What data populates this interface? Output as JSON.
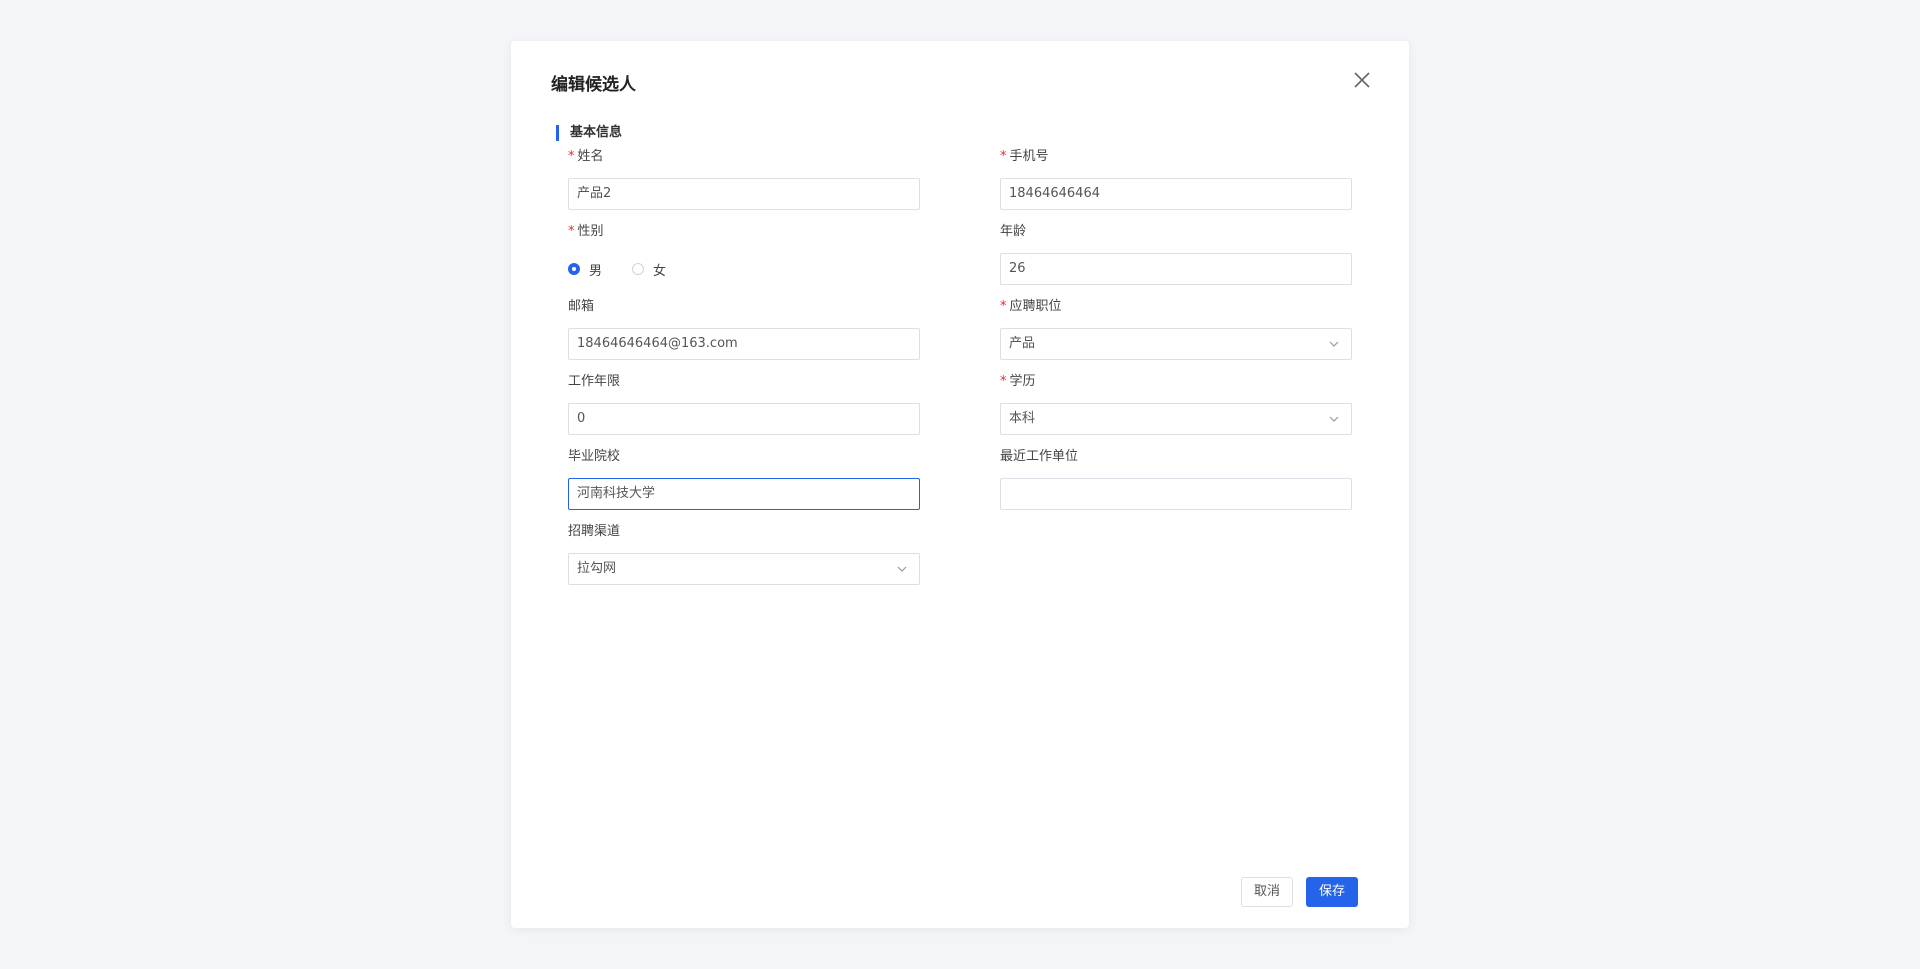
{
  "dialog": {
    "title": "编辑候选人",
    "section_title": "基本信息",
    "cancel_label": "取消",
    "save_label": "保存"
  },
  "fields": {
    "name": {
      "label": "姓名",
      "required": "*",
      "value": "产品2"
    },
    "phone": {
      "label": "手机号",
      "required": "*",
      "value": "18464646464"
    },
    "gender": {
      "label": "性别",
      "required": "*",
      "options": [
        "男",
        "女"
      ],
      "selected": "男"
    },
    "age": {
      "label": "年龄",
      "value": "26"
    },
    "email": {
      "label": "邮箱",
      "value": "18464646464@163.com"
    },
    "position": {
      "label": "应聘职位",
      "required": "*",
      "value": "产品"
    },
    "work_years": {
      "label": "工作年限",
      "value": "0"
    },
    "education": {
      "label": "学历",
      "required": "*",
      "value": "本科"
    },
    "school": {
      "label": "毕业院校",
      "value": "河南科技大学"
    },
    "recent_company": {
      "label": "最近工作单位",
      "value": ""
    },
    "channel": {
      "label": "招聘渠道",
      "value": "拉勾网"
    }
  },
  "icons": {
    "close": "close-icon",
    "dropdown": "chevron-down-icon"
  },
  "colors": {
    "primary": "#2563eb",
    "required": "#f5222d",
    "background": "#f4f5f8"
  }
}
